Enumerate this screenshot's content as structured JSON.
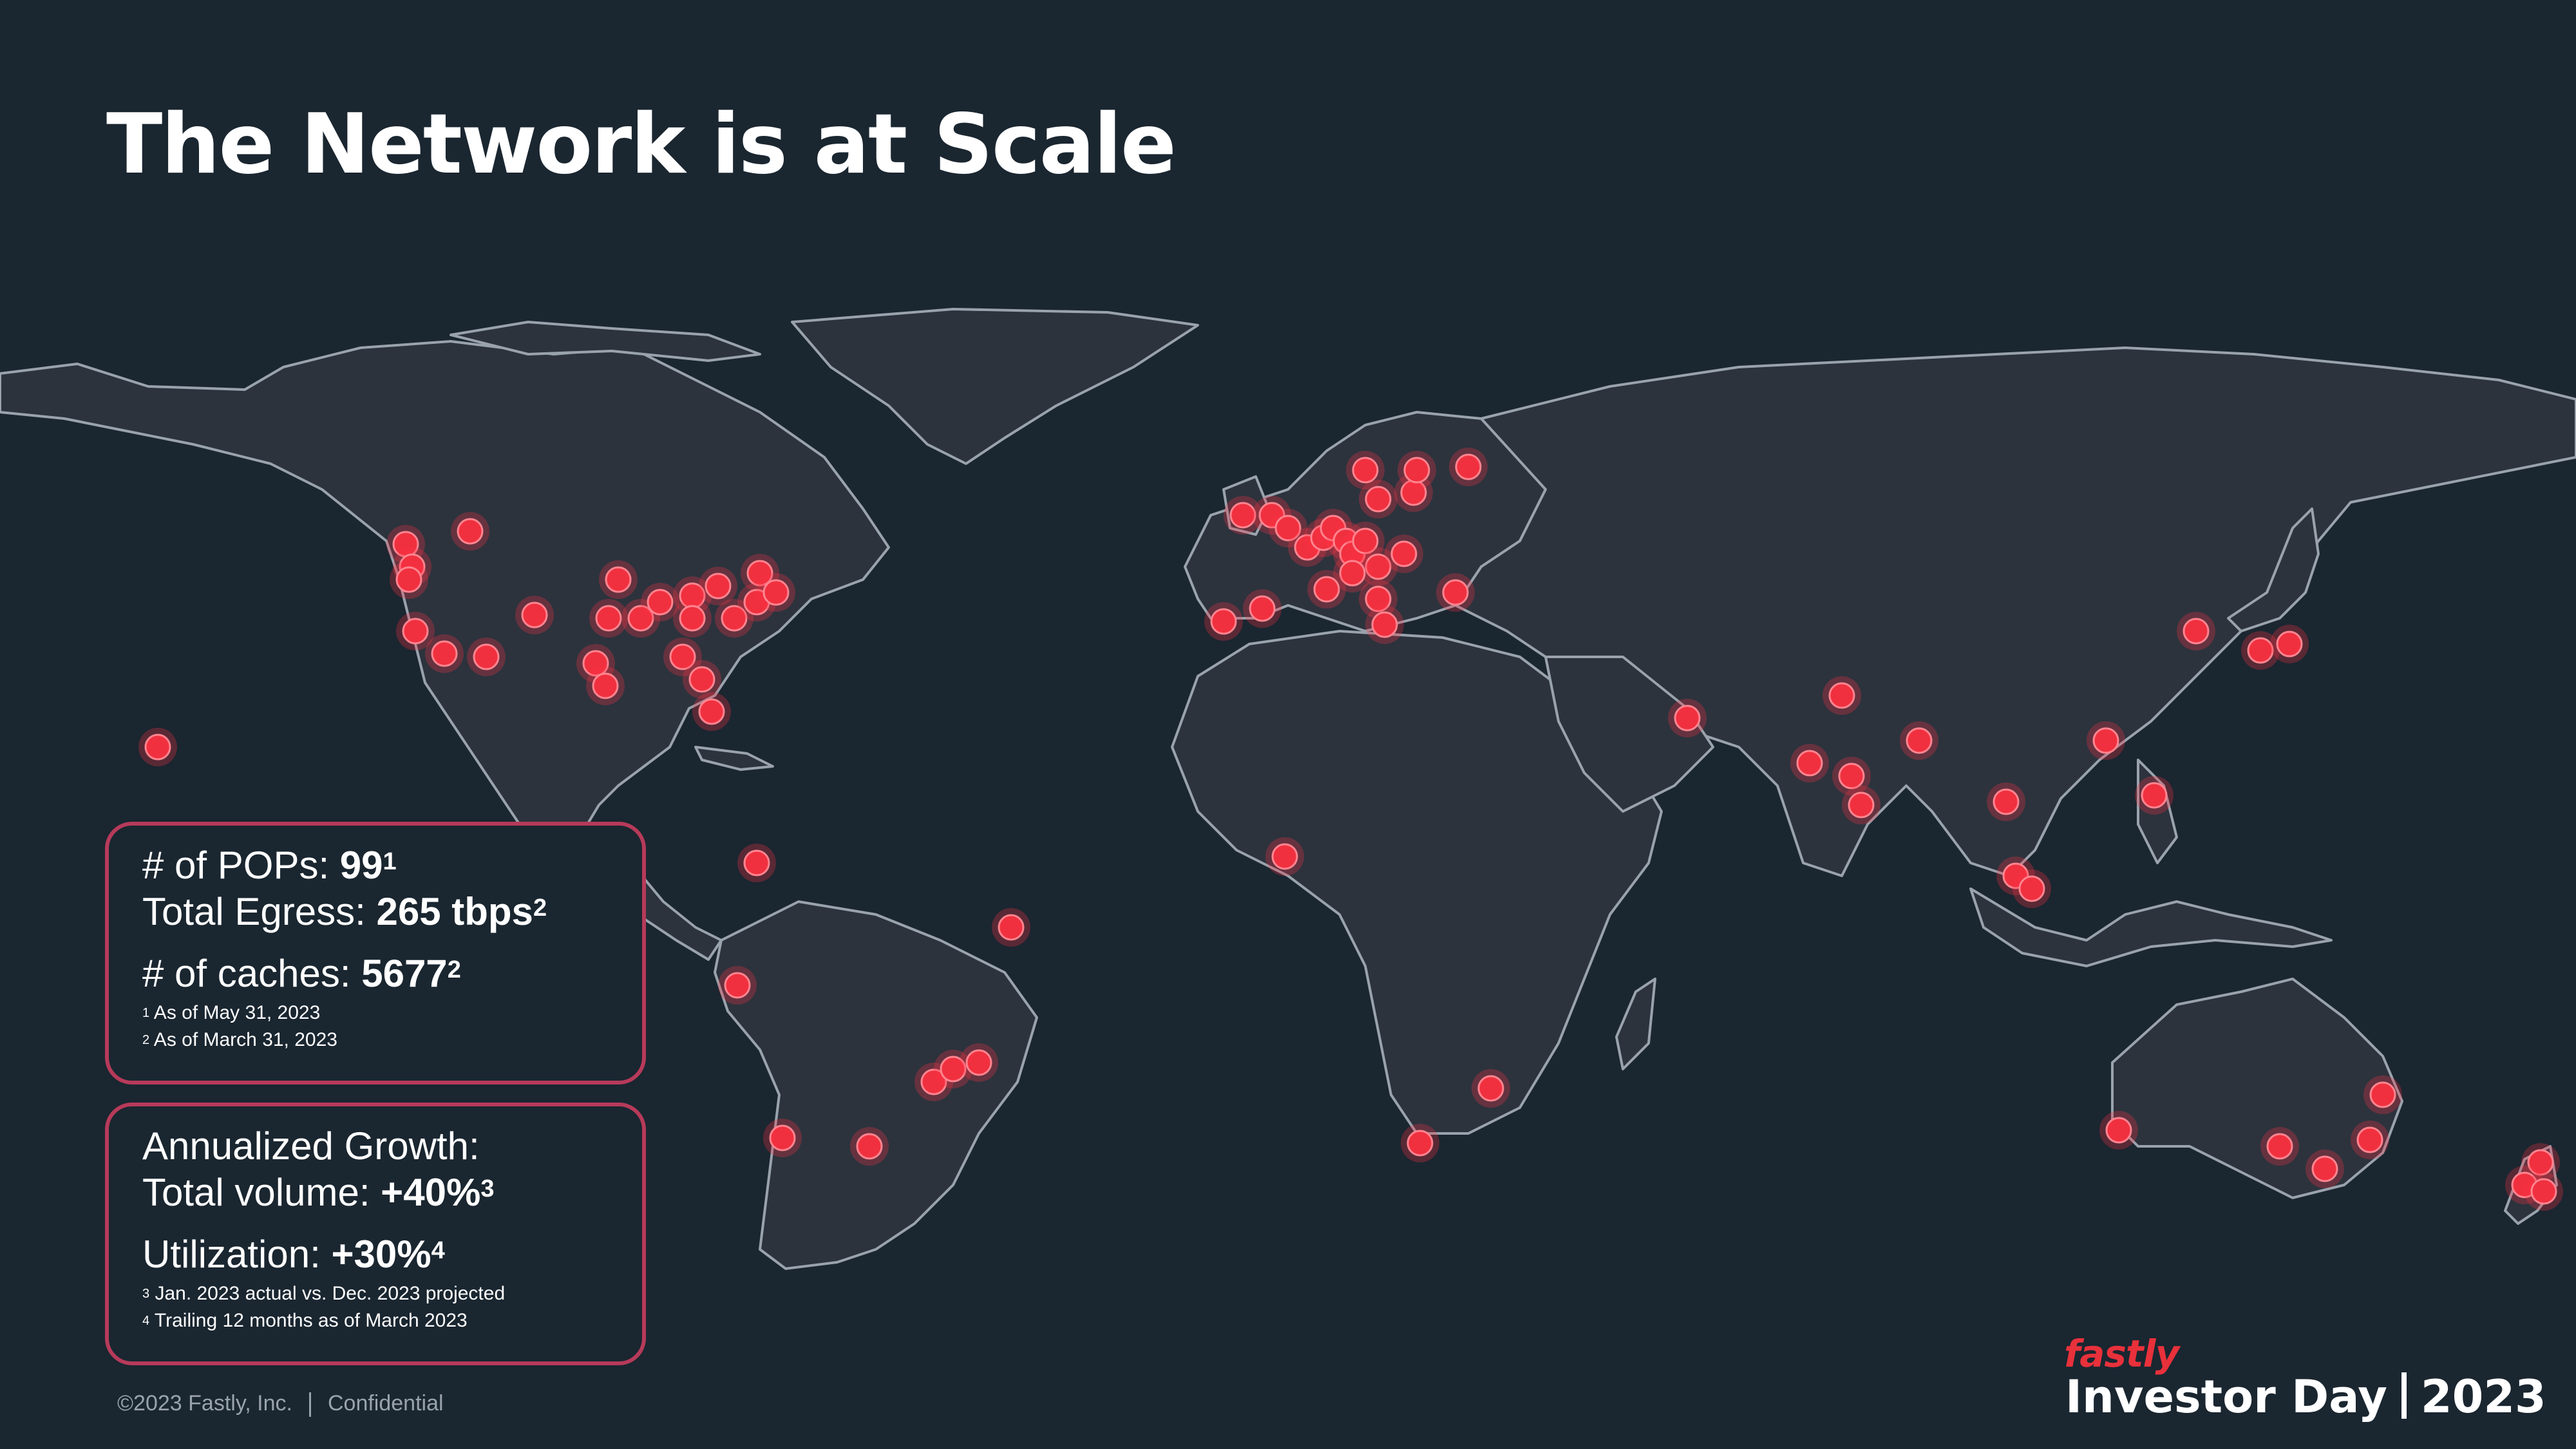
{
  "title": "The Network is at Scale",
  "stats": {
    "pops_label": "# of POPs: ",
    "pops_value": "99",
    "pops_note_ref": "1",
    "egress_label": "Total Egress: ",
    "egress_value": "265 tbps",
    "egress_note_ref": "2",
    "caches_label": "# of caches: ",
    "caches_value": "5677",
    "caches_note_ref": "2",
    "footnote1_ref": "1",
    "footnote1": " As of May 31, 2023",
    "footnote2_ref": "2",
    "footnote2": " As of March 31, 2023"
  },
  "growth": {
    "heading": "Annualized Growth:",
    "volume_label": "Total volume: ",
    "volume_value": "+40%",
    "volume_note_ref": "3",
    "util_label": "Utilization: ",
    "util_value": "+30%",
    "util_note_ref": "4",
    "footnote3_ref": "3",
    "footnote3": " Jan. 2023 actual vs. Dec. 2023 projected",
    "footnote4_ref": "4",
    "footnote4": " Trailing 12 months as of March 2023"
  },
  "footer": {
    "copyright": "©2023 Fastly, Inc.",
    "confidential": "Confidential"
  },
  "brand": {
    "logo": "fastly",
    "event": "Investor Day",
    "year": "2023"
  },
  "colors": {
    "background": "#1a2630",
    "land": "#2c333d",
    "pop_marker": "#f0303f",
    "box_border": "#b73a5a",
    "brand_red": "#e8313b"
  }
}
